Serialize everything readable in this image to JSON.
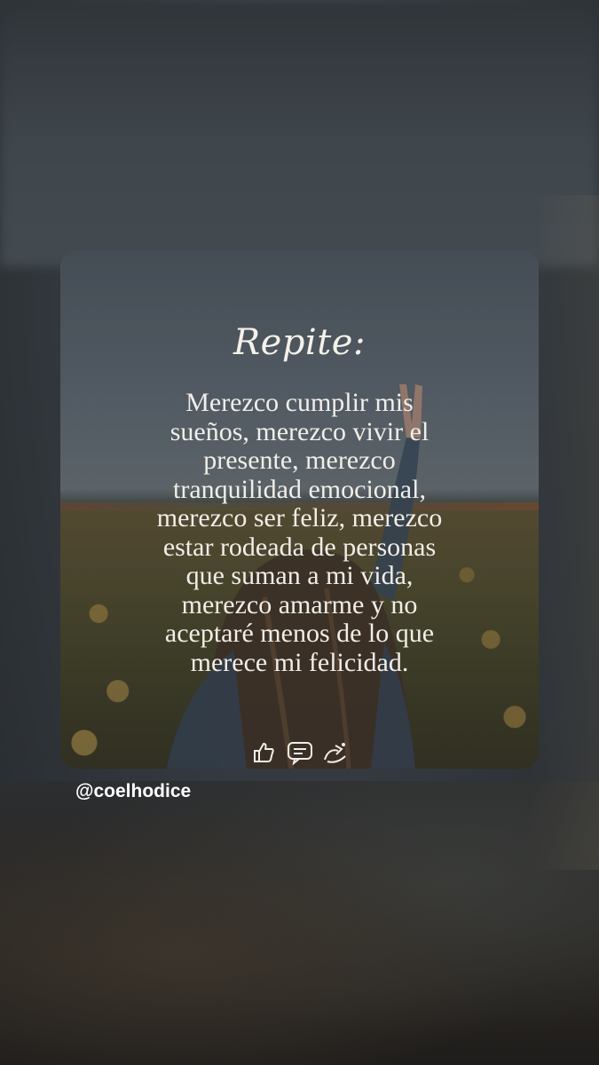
{
  "post": {
    "title": "Repite:",
    "body": "Merezco cumplir mis\nsueños, merezco vivir el\npresente, merezco\ntranquilidad emocional,\nmerezco ser feliz, merezco\nestar rodeada de personas\nque suman a mi vida,\nmerezco amarme y no\naceptaré menos de lo que\nmerece mi felicidad.",
    "reactions": [
      "thumbs-up-icon",
      "comment-icon",
      "share-icon"
    ]
  },
  "account": {
    "handle": "@coelhodice"
  },
  "colors": {
    "text": "#f1eee8",
    "handle": "#ffffff"
  }
}
